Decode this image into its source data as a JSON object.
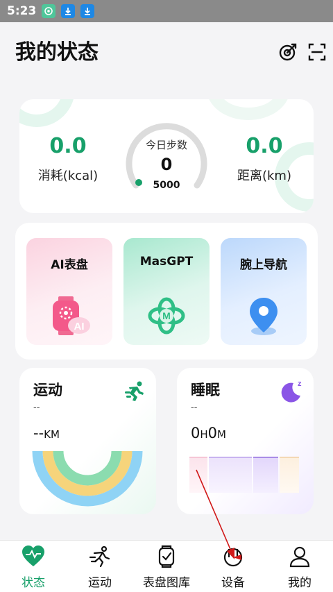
{
  "status_bar": {
    "time": "5:23"
  },
  "header": {
    "title": "我的状态"
  },
  "steps": {
    "left_value": "0.0",
    "left_label": "消耗(kcal)",
    "center_title": "今日步数",
    "center_value": "0",
    "center_goal": "5000",
    "right_value": "0.0",
    "right_label": "距离(km)"
  },
  "features": [
    {
      "label": "AI表盘",
      "icon": "ai-watch-icon"
    },
    {
      "label": "MasGPT",
      "icon": "gpt-knot-icon"
    },
    {
      "label": "腕上导航",
      "icon": "location-pin-icon"
    }
  ],
  "sport": {
    "title": "运动",
    "dash": "--",
    "value": "--",
    "unit": "KM"
  },
  "sleep": {
    "title": "睡眠",
    "dash": "--",
    "h_value": "0",
    "h_unit": "H",
    "m_value": "0",
    "m_unit": "M"
  },
  "tabs": [
    {
      "label": "状态",
      "icon": "heart-icon"
    },
    {
      "label": "运动",
      "icon": "running-icon"
    },
    {
      "label": "表盘图库",
      "icon": "watch-face-icon"
    },
    {
      "label": "设备",
      "icon": "device-icon"
    },
    {
      "label": "我的",
      "icon": "user-icon"
    }
  ],
  "colors": {
    "accent": "#18a06a",
    "annotation": "#d11a1a"
  }
}
